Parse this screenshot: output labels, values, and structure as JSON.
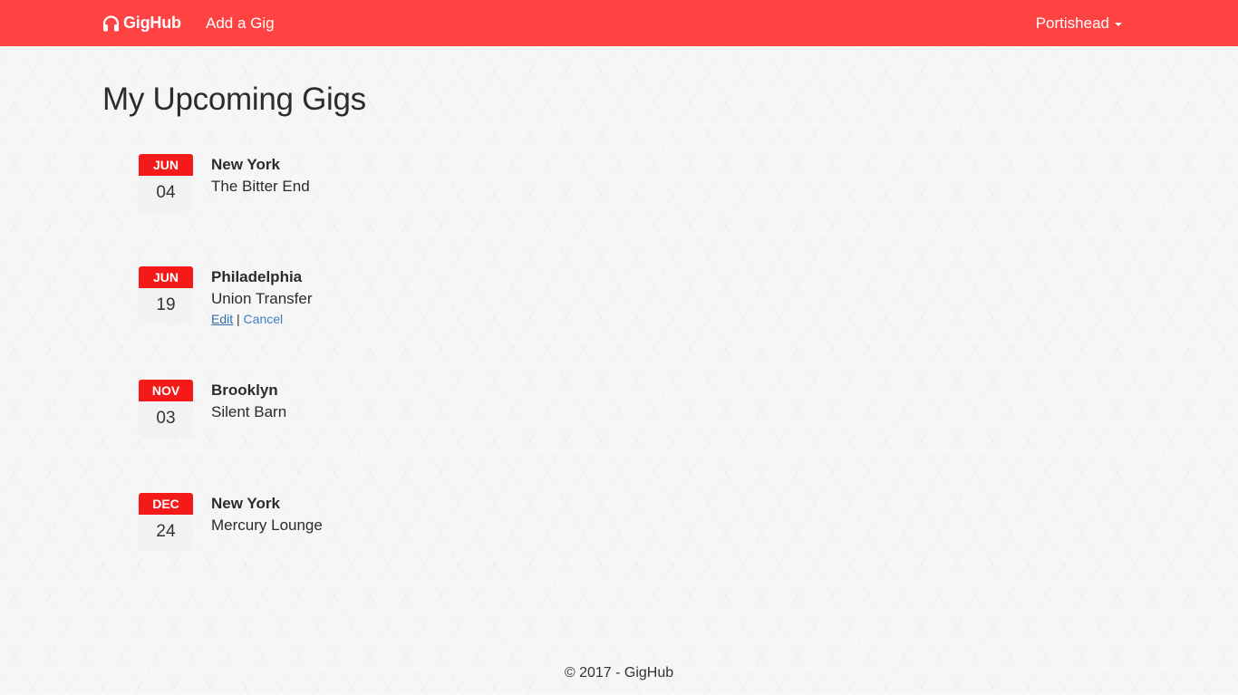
{
  "navbar": {
    "brand": "GigHub",
    "brand_icon": "headphones-icon",
    "add_gig": "Add a Gig",
    "user": "Portishead",
    "background": "#ff4343"
  },
  "page": {
    "title": "My Upcoming Gigs"
  },
  "gigs": [
    {
      "month": "JUN",
      "day": "04",
      "city": "New York",
      "venue": "The Bitter End"
    },
    {
      "month": "JUN",
      "day": "19",
      "city": "Philadelphia",
      "venue": "Union Transfer",
      "edit_label": "Edit",
      "separator": "|",
      "cancel_label": "Cancel"
    },
    {
      "month": "NOV",
      "day": "03",
      "city": "Brooklyn",
      "venue": "Silent Barn"
    },
    {
      "month": "DEC",
      "day": "24",
      "city": "New York",
      "venue": "Mercury Lounge"
    }
  ],
  "footer": {
    "text": "© 2017 - GigHub"
  },
  "colors": {
    "accent": "#ff4343",
    "calendar_month": "#f51a1a",
    "link": "#3f7fc0"
  }
}
